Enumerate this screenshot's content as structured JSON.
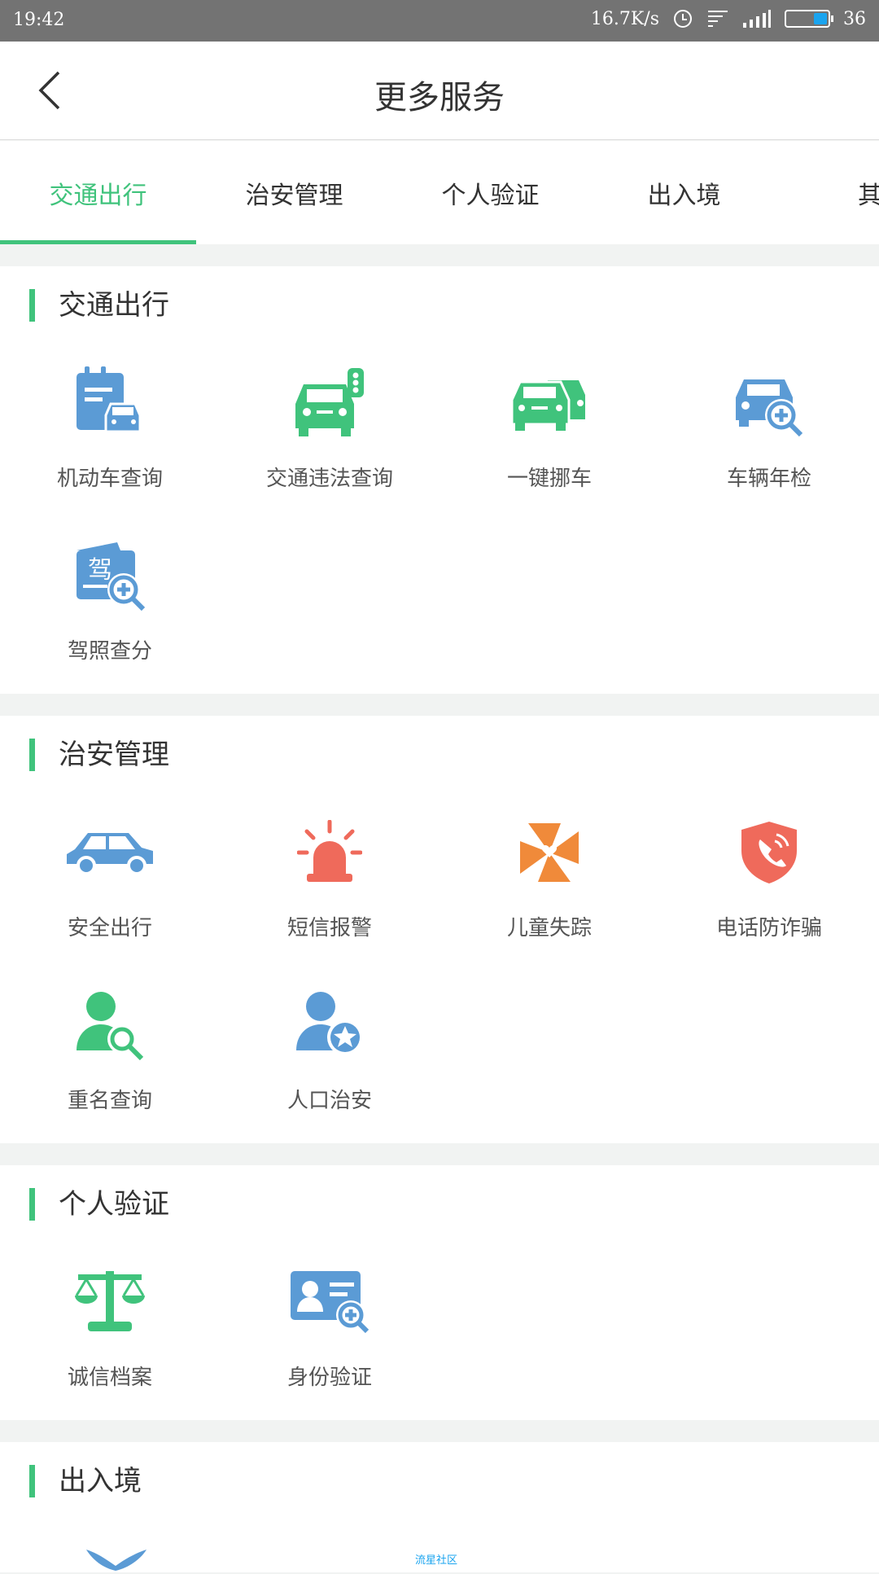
{
  "status": {
    "time": "19:42",
    "speed": "16.7K/s",
    "battery": "36"
  },
  "header": {
    "title": "更多服务"
  },
  "tabs": [
    "交通出行",
    "治安管理",
    "个人验证",
    "出入境",
    "其"
  ],
  "sections": [
    {
      "title": "交通出行",
      "items": [
        "机动车查询",
        "交通违法查询",
        "一键挪车",
        "车辆年检",
        "驾照查分"
      ]
    },
    {
      "title": "治安管理",
      "items": [
        "安全出行",
        "短信报警",
        "儿童失踪",
        "电话防诈骗",
        "重名查询",
        "人口治安"
      ]
    },
    {
      "title": "个人验证",
      "items": [
        "诚信档案",
        "身份验证"
      ]
    },
    {
      "title": "出入境",
      "items": []
    }
  ],
  "colors": {
    "accent": "#40c37c",
    "blue": "#5b9bd5",
    "red": "#ef6a5b",
    "orange": "#f08a3a"
  },
  "bottom_small_text": "流星社区"
}
